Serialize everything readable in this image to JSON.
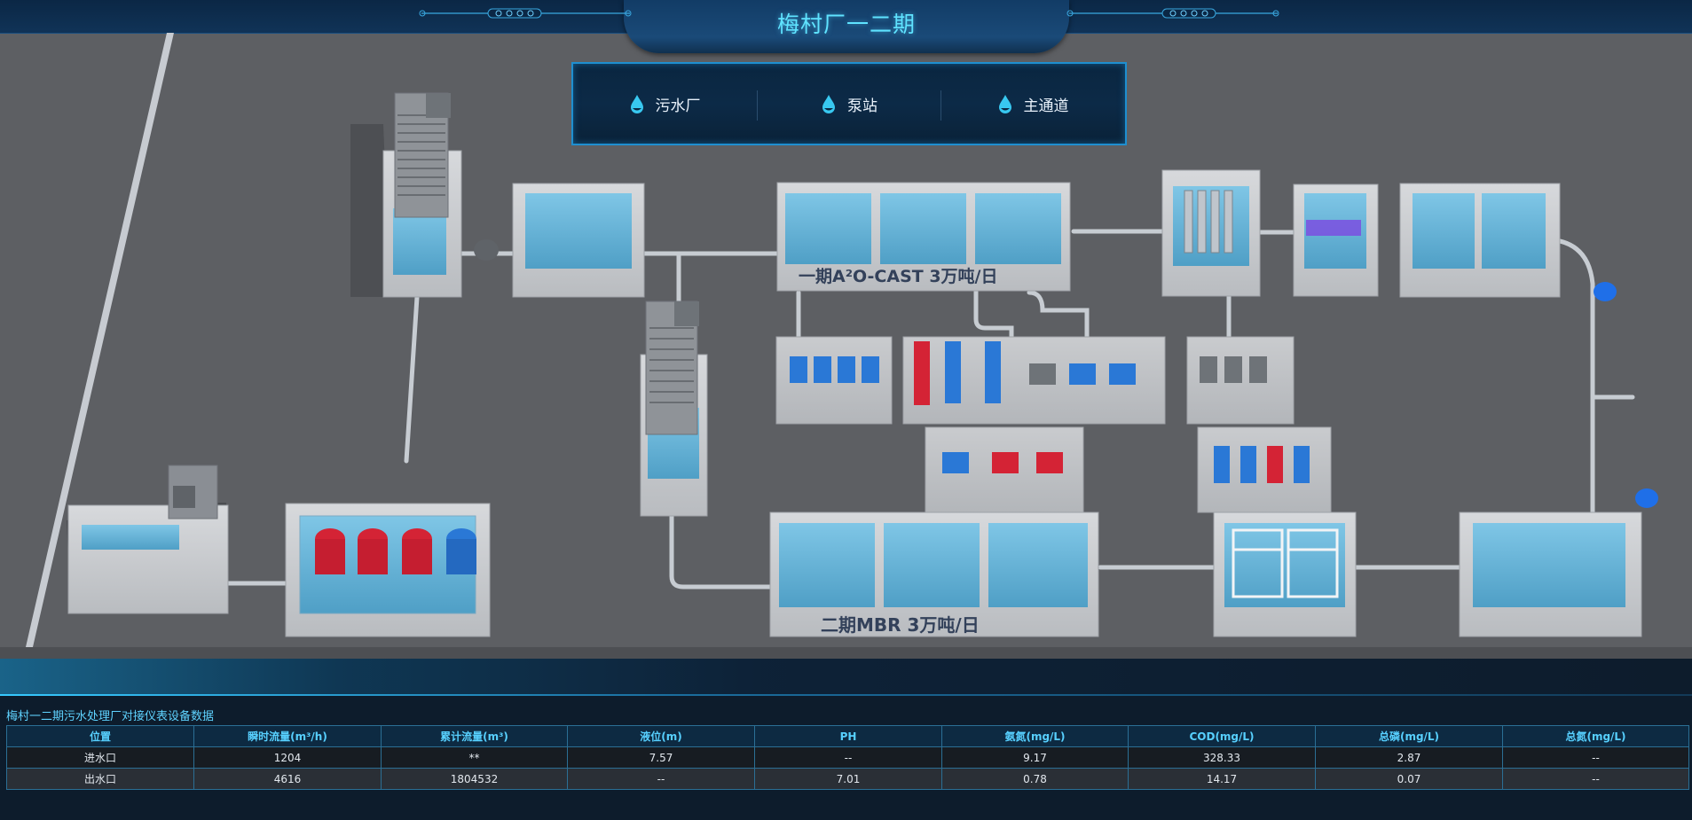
{
  "header": {
    "title": "梅村厂一二期"
  },
  "nav": {
    "items": [
      {
        "label": "污水厂",
        "icon": "water-drop-icon"
      },
      {
        "label": "泵站",
        "icon": "water-drop-icon"
      },
      {
        "label": "主通道",
        "icon": "water-drop-icon"
      }
    ]
  },
  "scene": {
    "phase1_label": "一期A²O-CAST 3万吨/日",
    "phase2_label": "二期MBR 3万吨/日"
  },
  "colors": {
    "accent": "#5fe3ff",
    "panel_border": "#1e8fd0",
    "water": "#5fb3d6",
    "pump_red": "#d42335",
    "pump_blue": "#2a78d6"
  },
  "table": {
    "title": "梅村一二期污水处理厂对接仪表设备数据",
    "headers": [
      "位置",
      "瞬时流量(m³/h)",
      "累计流量(m³)",
      "液位(m)",
      "PH",
      "氨氮(mg/L)",
      "COD(mg/L)",
      "总磷(mg/L)",
      "总氮(mg/L)"
    ],
    "rows": [
      [
        "进水口",
        "1204",
        "**",
        "7.57",
        "--",
        "9.17",
        "328.33",
        "2.87",
        "--"
      ],
      [
        "出水口",
        "4616",
        "1804532",
        "--",
        "7.01",
        "0.78",
        "14.17",
        "0.07",
        "--"
      ]
    ]
  }
}
